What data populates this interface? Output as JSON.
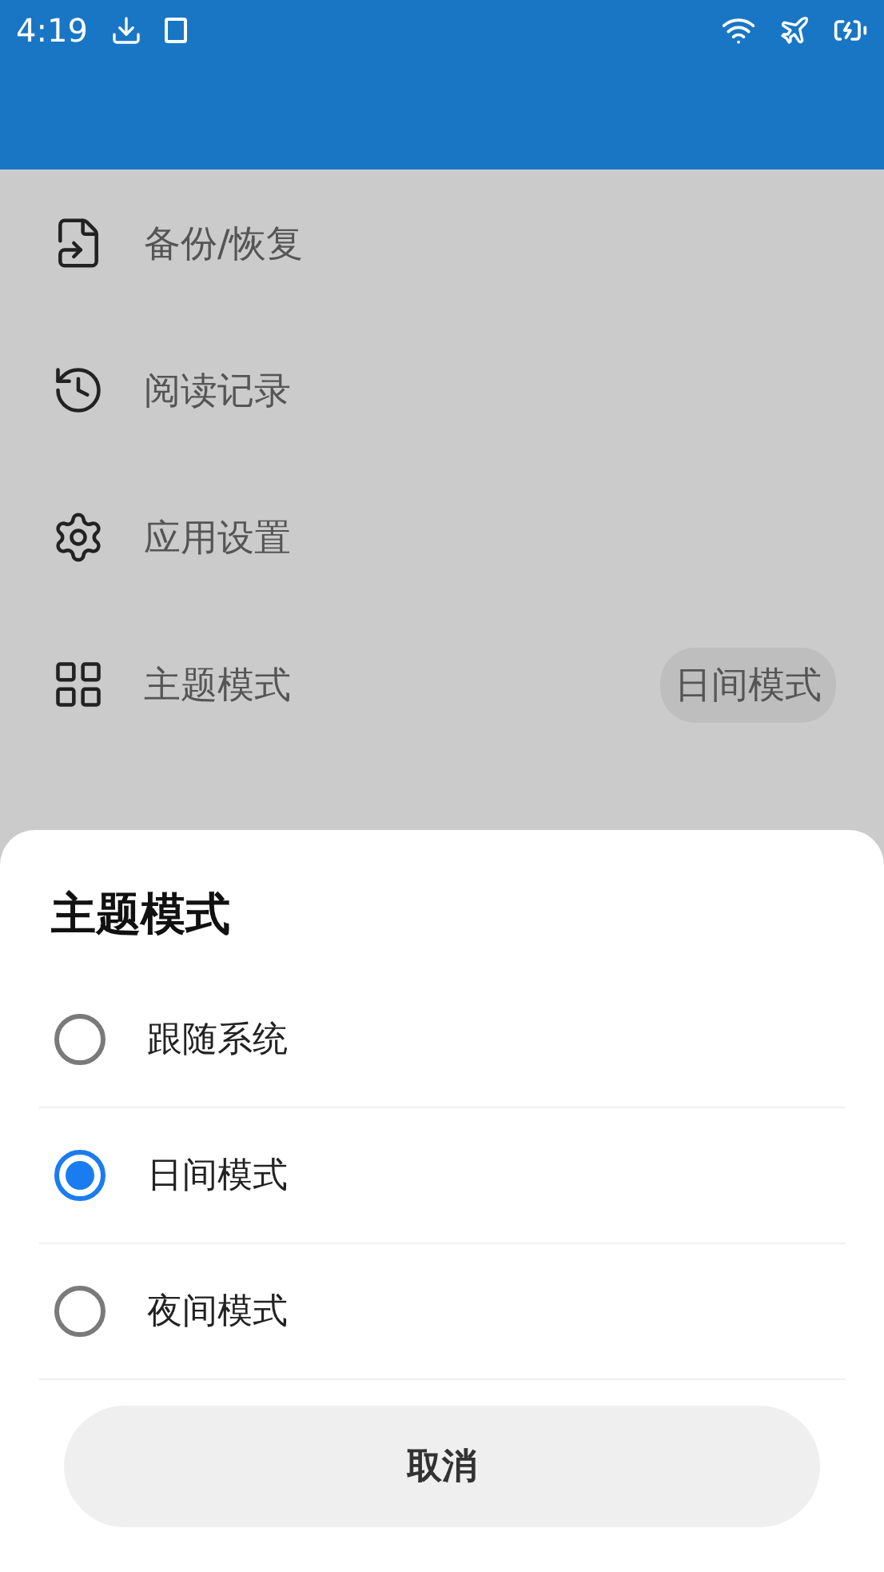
{
  "status_bar": {
    "time": "4:19"
  },
  "menu": [
    {
      "kind": "backup",
      "label": "备份/恢复"
    },
    {
      "kind": "history",
      "label": "阅读记录"
    },
    {
      "kind": "settings",
      "label": "应用设置"
    },
    {
      "kind": "theme",
      "label": "主题模式",
      "value": "日间模式"
    }
  ],
  "sheet": {
    "title": "主题模式",
    "options": [
      {
        "label": "跟随系统",
        "selected": false
      },
      {
        "label": "日间模式",
        "selected": true
      },
      {
        "label": "夜间模式",
        "selected": false
      }
    ],
    "cancel": "取消"
  }
}
